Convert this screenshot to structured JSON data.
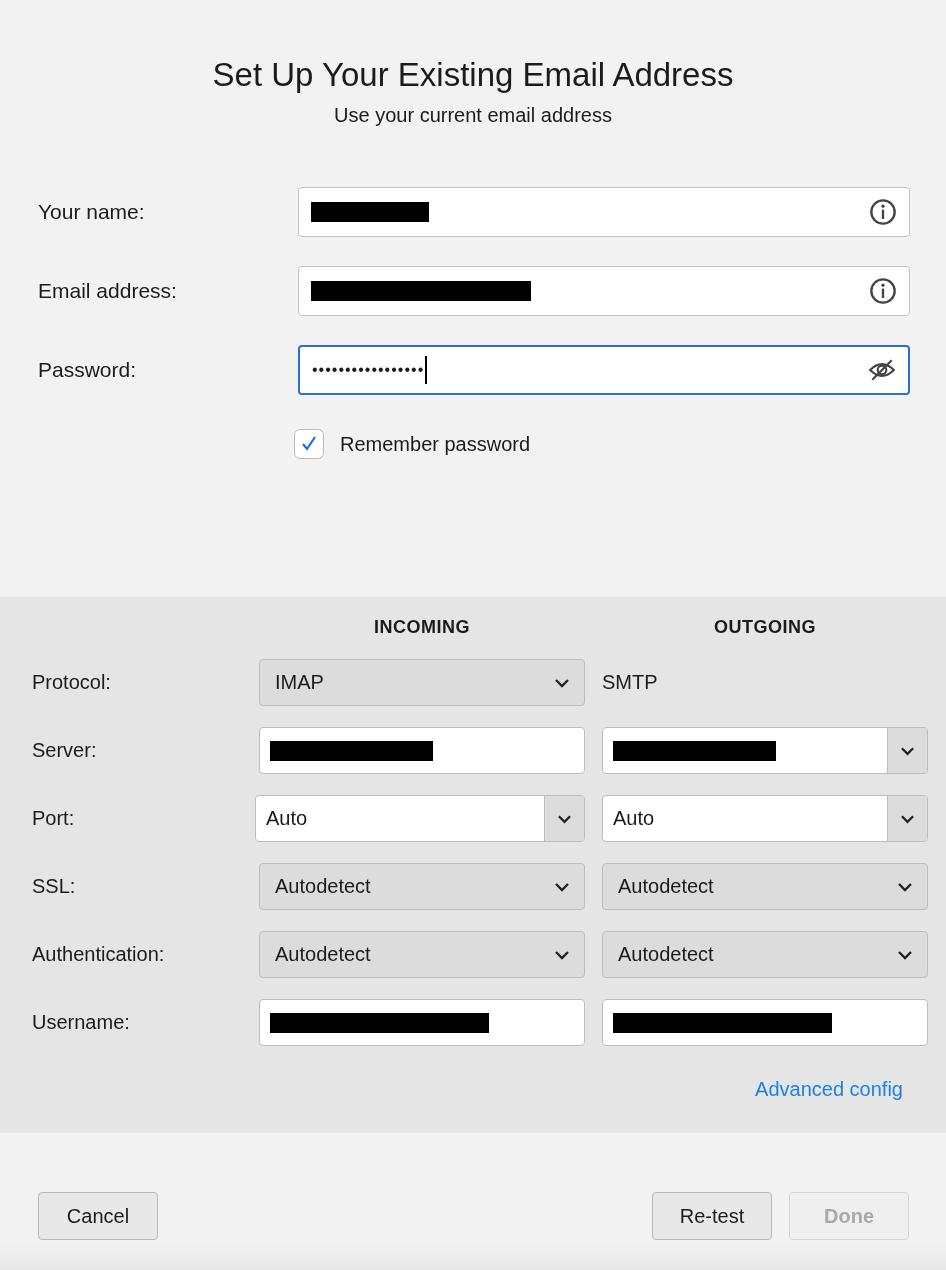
{
  "title": "Set Up Your Existing Email Address",
  "subtitle": "Use your current email address",
  "account_fields": [
    {
      "label": "Your name:",
      "kind": "text",
      "redacted": true,
      "focused": false
    },
    {
      "label": "Email address:",
      "kind": "text",
      "redacted": true,
      "focused": false
    },
    {
      "label": "Password:",
      "kind": "password",
      "value": "•••••••••••••••••",
      "focused": true
    }
  ],
  "remember_password": {
    "label": "Remember password",
    "checked": true
  },
  "server_settings": {
    "columns": [
      "INCOMING",
      "OUTGOING"
    ],
    "rows": [
      {
        "label": "Protocol:",
        "incoming": {
          "kind": "select",
          "value": "IMAP"
        },
        "outgoing": {
          "kind": "static",
          "value": "SMTP"
        }
      },
      {
        "label": "Server:",
        "incoming": {
          "kind": "text",
          "redacted": true
        },
        "outgoing": {
          "kind": "combo",
          "redacted": true
        }
      },
      {
        "label": "Port:",
        "incoming": {
          "kind": "combo",
          "value": "Auto"
        },
        "outgoing": {
          "kind": "combo",
          "value": "Auto"
        }
      },
      {
        "label": "SSL:",
        "incoming": {
          "kind": "select",
          "value": "Autodetect"
        },
        "outgoing": {
          "kind": "select",
          "value": "Autodetect"
        }
      },
      {
        "label": "Authentication:",
        "incoming": {
          "kind": "select",
          "value": "Autodetect"
        },
        "outgoing": {
          "kind": "select",
          "value": "Autodetect"
        }
      },
      {
        "label": "Username:",
        "incoming": {
          "kind": "text",
          "redacted": true
        },
        "outgoing": {
          "kind": "text",
          "redacted": true
        }
      }
    ]
  },
  "advanced_link": "Advanced config",
  "buttons": [
    {
      "label": "Cancel",
      "disabled": false
    },
    {
      "label": "Re-test",
      "disabled": false
    },
    {
      "label": "Done",
      "disabled": true
    }
  ]
}
